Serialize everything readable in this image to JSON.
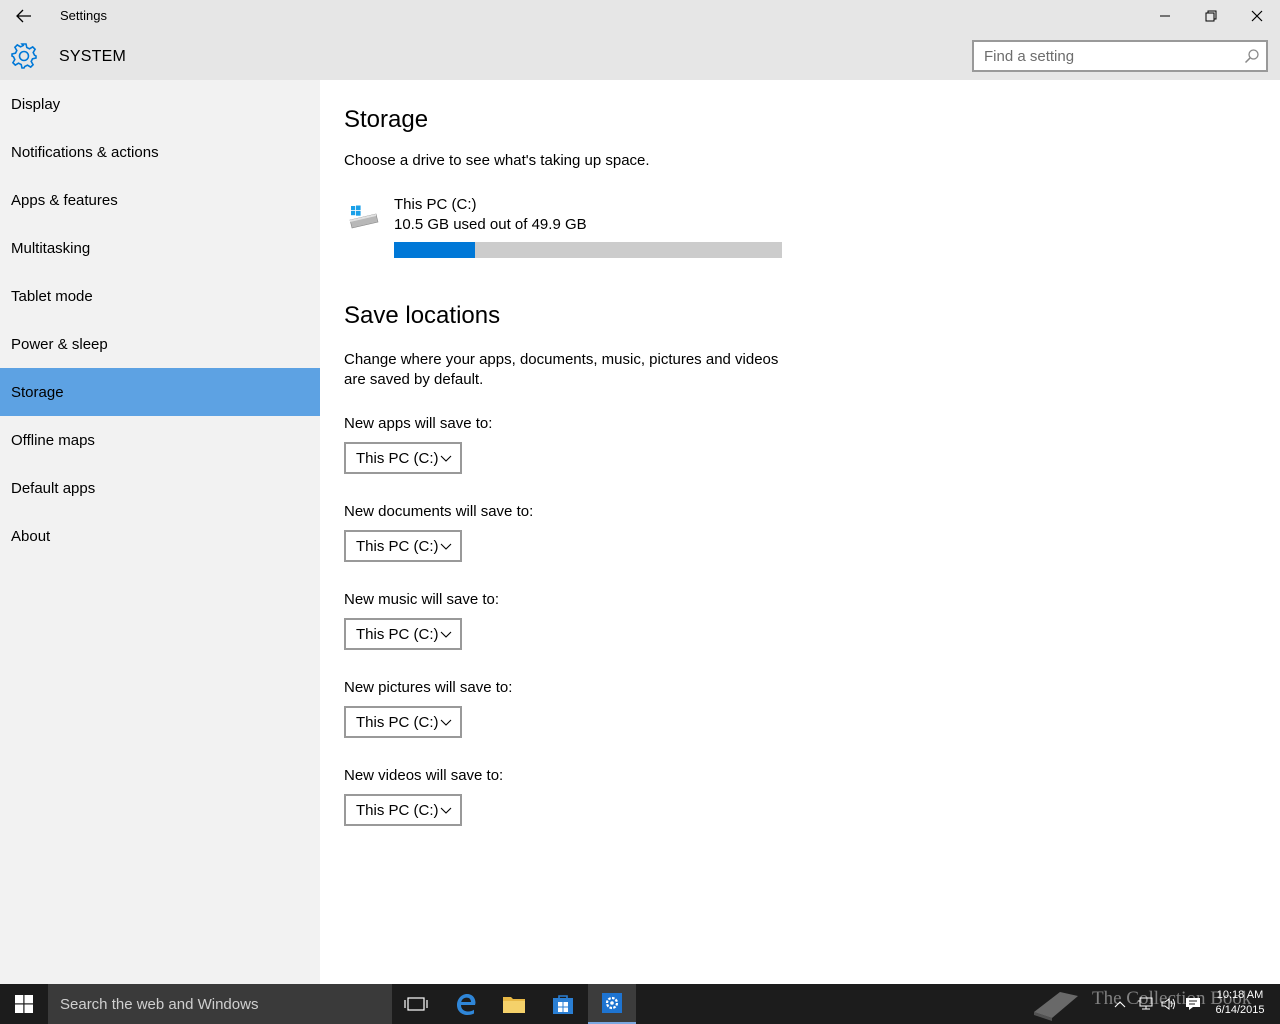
{
  "window": {
    "title": "Settings",
    "back_icon": "back-arrow-icon",
    "controls": [
      "minimize-icon",
      "restore-icon",
      "close-icon"
    ]
  },
  "header": {
    "icon": "gear-icon",
    "section": "SYSTEM",
    "search_placeholder": "Find a setting"
  },
  "sidebar": {
    "items": [
      {
        "label": "Display"
      },
      {
        "label": "Notifications & actions"
      },
      {
        "label": "Apps & features"
      },
      {
        "label": "Multitasking"
      },
      {
        "label": "Tablet mode"
      },
      {
        "label": "Power & sleep"
      },
      {
        "label": "Storage",
        "selected": true
      },
      {
        "label": "Offline maps"
      },
      {
        "label": "Default apps"
      },
      {
        "label": "About"
      }
    ]
  },
  "storage": {
    "heading": "Storage",
    "description": "Choose a drive to see what's taking up space.",
    "drive": {
      "icon": "drive-icon",
      "name": "This PC (C:)",
      "usage": "10.5 GB used out of 49.9 GB",
      "used_fraction": 0.21
    }
  },
  "save_locations": {
    "heading": "Save locations",
    "description_line1": "Change where your apps, documents, music, pictures and videos",
    "description_line2": "are saved by default.",
    "items": [
      {
        "label": "New apps will save to:",
        "value": "This PC (C:)"
      },
      {
        "label": "New documents will save to:",
        "value": "This PC (C:)"
      },
      {
        "label": "New music will save to:",
        "value": "This PC (C:)"
      },
      {
        "label": "New pictures will save to:",
        "value": "This PC (C:)"
      },
      {
        "label": "New videos will save to:",
        "value": "This PC (C:)"
      }
    ]
  },
  "taskbar": {
    "search_text": "Search the web and Windows",
    "time": "10:18 AM",
    "date": "6/14/2015",
    "watermark": "The Collection Book",
    "colors": {
      "accent": "#0078d7",
      "selected_nav": "#5da2e3"
    }
  }
}
